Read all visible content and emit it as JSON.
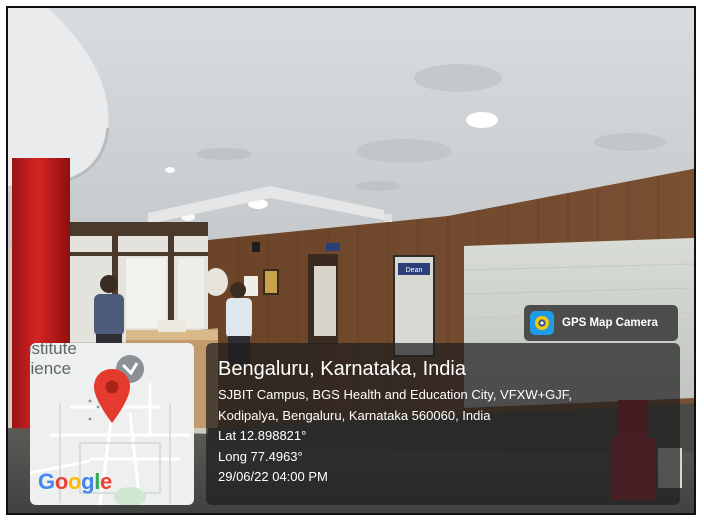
{
  "badge": {
    "label": "GPS Map Camera",
    "icon": "gps-map-camera-icon"
  },
  "map": {
    "text_line_1": "nstitute",
    "text_line_2": "cience",
    "logo_text": "Google",
    "pin_icon": "map-pin-icon",
    "colors": {
      "pin": "#e53b2f",
      "background": "#eef0f0"
    }
  },
  "location": {
    "title": "Bengaluru, Karnataka, India",
    "address_line_1": "SJBIT Campus, BGS Health and Education City, VFXW+GJF,",
    "address_line_2": "Kodipalya, Bengaluru, Karnataka 560060, India",
    "lat": "Lat 12.898821°",
    "long": "Long 77.4963°",
    "datetime": "29/06/22 04:00 PM"
  },
  "sign": {
    "text": "Dean"
  }
}
